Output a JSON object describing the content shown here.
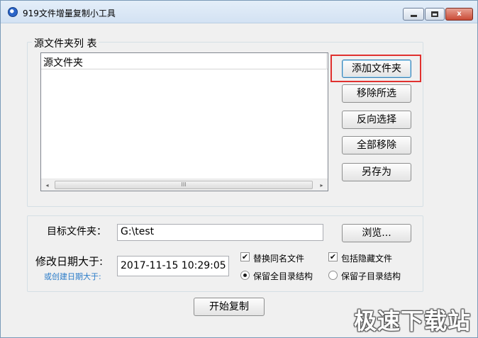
{
  "window": {
    "title": "919文件增量复制小工具",
    "controls": {
      "minimize_icon": "minimize-icon",
      "maximize_icon": "maximize-icon",
      "close_glyph": "x"
    }
  },
  "source_group": {
    "legend": "源文件夹列 表",
    "list": {
      "column_header": "源文件夹",
      "items": [],
      "scrollbar": {
        "left_arrow": "◂",
        "right_arrow": "▸",
        "thumb_grip": "III"
      }
    },
    "buttons": {
      "add_folder": "添加文件夹",
      "remove_selected": "移除所选",
      "invert_selection": "反向选择",
      "remove_all": "全部移除",
      "save_as": "另存为"
    }
  },
  "target_group": {
    "target_label": "目标文件夹：",
    "target_value": "G:\\test",
    "browse": "浏览...",
    "modified_label": "修改日期大于:",
    "created_label": "或创建日期大于:",
    "date_value": "2017-11-15 10:29:05",
    "options": {
      "replace_same_name": {
        "label": "替换同名文件",
        "checked": true
      },
      "include_hidden": {
        "label": "包括隐藏文件",
        "checked": true
      },
      "keep_full_structure": {
        "label": "保留全目录结构",
        "selected": true
      },
      "keep_sub_structure": {
        "label": "保留子目录结构",
        "selected": false
      }
    }
  },
  "start_button": "开始复制",
  "watermark": "极速下载站",
  "colors": {
    "highlight_box": "#e0312f",
    "created_label": "#2b7cc9",
    "close_button": "#c94a35"
  }
}
